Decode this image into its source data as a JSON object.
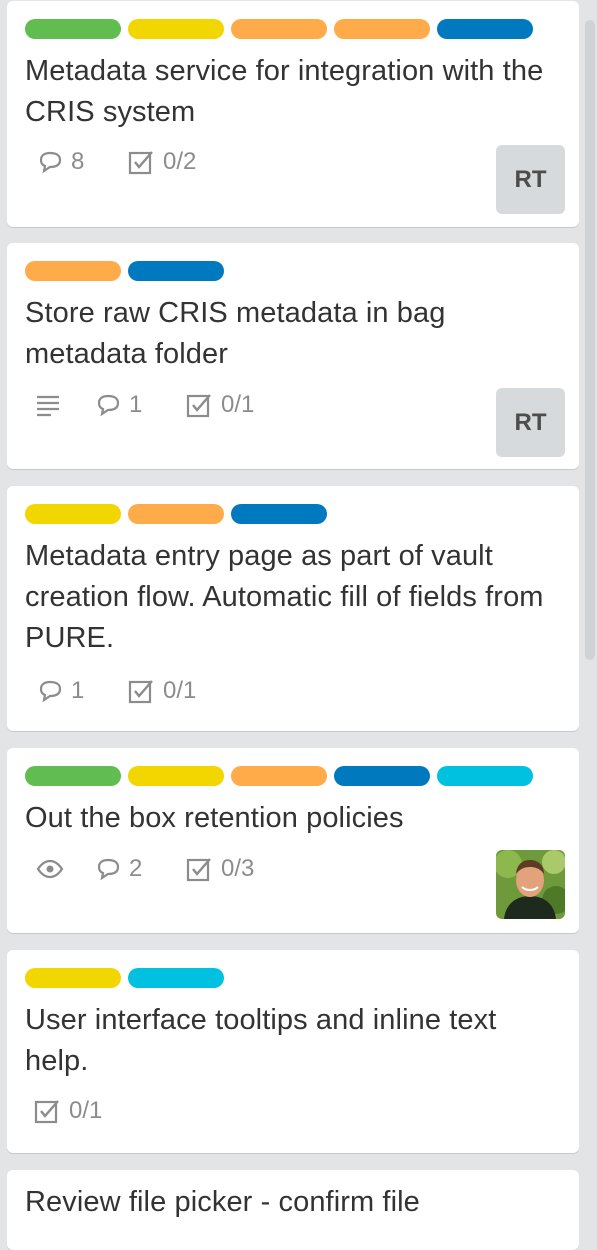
{
  "colors": {
    "green": "#61bd4f",
    "yellow": "#f2d600",
    "orange": "#ffab4a",
    "blue": "#0079bf",
    "sky": "#00c2e0"
  },
  "cards": [
    {
      "title": "Metadata service for integration with the CRIS system",
      "labels": [
        "green",
        "yellow",
        "orange",
        "orange",
        "blue"
      ],
      "badges": {
        "comments": "8",
        "checklist": "0/2"
      },
      "member": "RT"
    },
    {
      "title": "Store raw CRIS metadata in bag metadata folder",
      "labels": [
        "orange",
        "blue"
      ],
      "badges": {
        "description": true,
        "comments": "1",
        "checklist": "0/1"
      },
      "member": "RT"
    },
    {
      "title": "Metadata entry page as part of vault creation flow. Automatic fill of fields from PURE.",
      "labels": [
        "yellow",
        "orange",
        "blue"
      ],
      "badges": {
        "comments": "1",
        "checklist": "0/1"
      }
    },
    {
      "title": "Out the box retention policies",
      "labels": [
        "green",
        "yellow",
        "orange",
        "blue",
        "sky"
      ],
      "badges": {
        "watch": true,
        "comments": "2",
        "checklist": "0/3"
      },
      "member_avatar": "person-photo-icon"
    },
    {
      "title": "User interface tooltips and inline text help.",
      "labels": [
        "yellow",
        "sky"
      ],
      "badges": {
        "checklist": "0/1"
      }
    },
    {
      "title": "Review file picker - confirm file"
    }
  ]
}
